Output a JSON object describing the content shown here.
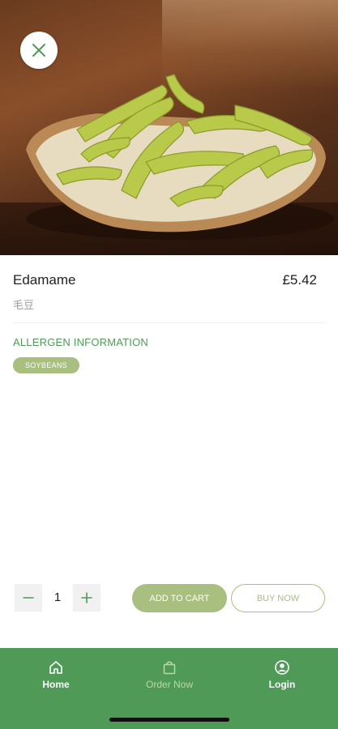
{
  "product": {
    "name": "Edamame",
    "subname": "毛豆",
    "price": "£5.42"
  },
  "allergens": {
    "title": "ALLERGEN INFORMATION",
    "items": [
      "SOYBEANS"
    ]
  },
  "quantity": {
    "value": "1"
  },
  "actions": {
    "add_to_cart": "ADD TO CART",
    "buy_now": "BUY NOW"
  },
  "nav": {
    "home": "Home",
    "order_now": "Order Now",
    "login": "Login"
  },
  "icons": {
    "close": "close-icon",
    "minus": "minus-icon",
    "plus": "plus-icon",
    "home": "home-icon",
    "bag": "shopping-bag-icon",
    "user": "user-circle-icon"
  },
  "colors": {
    "brand_green": "#4f9a57",
    "accent_olive": "#a8bf7f"
  }
}
